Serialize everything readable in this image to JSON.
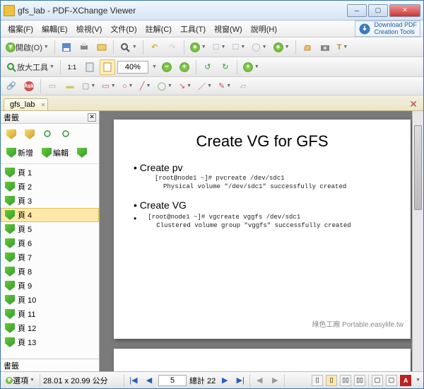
{
  "window": {
    "title": "gfs_lab - PDF-XChange Viewer"
  },
  "menu": {
    "file": "檔案(F)",
    "edit": "編輯(E)",
    "view": "檢視(V)",
    "document": "文件(D)",
    "comments": "註解(C)",
    "tools": "工具(T)",
    "window": "視窗(W)",
    "help": "說明(H)",
    "download1": "Download PDF",
    "download2": "Creation Tools"
  },
  "toolbar1": {
    "open": "開啟(O)"
  },
  "toolbar2": {
    "zoom_tool": "放大工具",
    "zoom_value": "40%"
  },
  "doc_tab": {
    "name": "gfs_lab"
  },
  "sidebar": {
    "title": "書籤",
    "new": "新增",
    "edit": "編輯",
    "items": [
      {
        "label": "頁 1"
      },
      {
        "label": "頁 2"
      },
      {
        "label": "頁 3"
      },
      {
        "label": "頁 4"
      },
      {
        "label": "頁 5"
      },
      {
        "label": "頁 6"
      },
      {
        "label": "頁 7"
      },
      {
        "label": "頁 8"
      },
      {
        "label": "頁 9"
      },
      {
        "label": "頁 10"
      },
      {
        "label": "頁 11"
      },
      {
        "label": "頁 12"
      },
      {
        "label": "頁 13"
      }
    ],
    "footer": "書籤"
  },
  "page": {
    "heading": "Create VG for GFS",
    "b1": "• Create pv",
    "c1a": "[root@node1 ~]# pvcreate /dev/sdc1",
    "c1b": "Physical volume \"/dev/sdc1\" successfully created",
    "b2": "• Create VG",
    "c2a": "[root@node1 ~]# vgcreate vggfs /dev/sdc1",
    "c2b": "Clustered volume group \"vggfs\" successfully created",
    "b2dot": "•",
    "watermark": "綠色工廠 Portable.easylife.tw"
  },
  "status": {
    "options": "選項",
    "dims": "28.01 x 20.99 公分",
    "page_current": "5",
    "page_total": "總計 22"
  }
}
